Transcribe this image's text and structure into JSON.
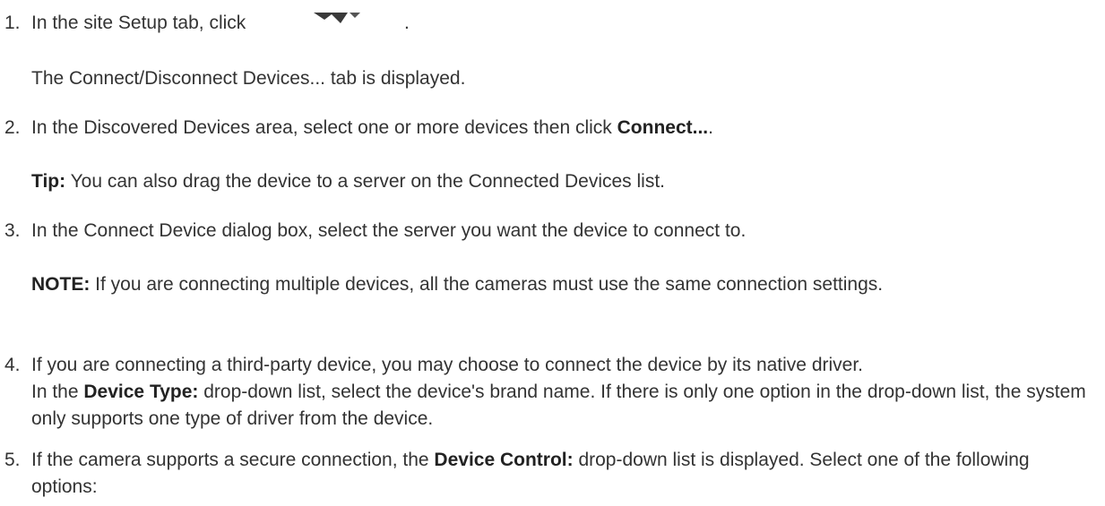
{
  "steps": [
    {
      "number": "1.",
      "text_before": "In the site Setup tab, click",
      "text_after": ".",
      "icon": "connect-disconnect-devices-icon",
      "result": "The Connect/Disconnect Devices... tab is displayed."
    },
    {
      "number": "2.",
      "text": "In the Discovered Devices area, select one or more devices then click ",
      "bold": "Connect...",
      "text_end": ".",
      "tip_label": "Tip:",
      "tip_text": " You can also drag the device to a server on the Connected Devices list."
    },
    {
      "number": "3.",
      "text": "In the Connect Device dialog box, select the server you want the device to connect to.",
      "note_label": "NOTE:",
      "note_text": " If you are connecting multiple devices, all the cameras must use the same connection settings."
    },
    {
      "number": "4.",
      "text_line1": "If you are connecting a third-party device, you may choose to connect the device by its native driver.",
      "text_a": "In the ",
      "bold": "Device Type:",
      "text_b": " drop-down list, select the device's brand name. If there is only one option in the drop-down list, the system only supports one type of driver from the device."
    },
    {
      "number": "5.",
      "text_a": "If the camera supports a secure connection, the ",
      "bold": "Device Control:",
      "text_b": " drop-down list is displayed. Select one of the following options:"
    }
  ]
}
